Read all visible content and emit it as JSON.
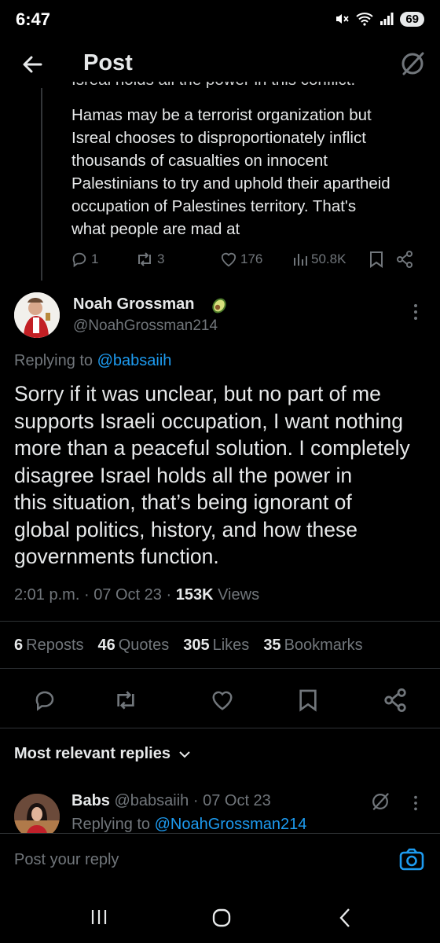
{
  "status": {
    "time": "6:47",
    "battery": "69"
  },
  "header": {
    "title": "Post"
  },
  "parent_tweet": {
    "cutoff_line": "Isreal holds all the power in this conflict.",
    "text": "Hamas may be a terrorist organization but\nIsreal chooses to disproportionately inflict\nthousands of casualties on innocent\nPalestinians to try and uphold their apartheid\noccupation of Palestines territory. That's\nwhat people are mad at",
    "replies": "1",
    "reposts": "3",
    "likes": "176",
    "views": "50.8K"
  },
  "main_tweet": {
    "author_name": "Noah Grossman",
    "author_handle": "@NoahGrossman214",
    "replying_prefix": "Replying to",
    "replying_handle": "@babsaiih",
    "body": "Sorry if it was unclear, but no part of me\nsupports Israeli occupation, I want nothing\nmore than a peaceful solution. I completely\ndisagree Israel holds all the power in\nthis situation, that’s being ignorant of\nglobal politics, history, and how these\ngovernments function.",
    "time": "2:01 p.m.",
    "date": "07 Oct 23",
    "views_count": "153K",
    "views_label": "Views",
    "separator": "·",
    "stats": {
      "reposts_count": "6",
      "reposts_label": "Reposts",
      "quotes_count": "46",
      "quotes_label": "Quotes",
      "likes_count": "305",
      "likes_label": "Likes",
      "bookmarks_count": "35",
      "bookmarks_label": "Bookmarks"
    }
  },
  "replies_section": {
    "sort_label": "Most relevant replies",
    "reply": {
      "name": "Babs",
      "handle": "@babsaiih",
      "separator": "·",
      "date": "07 Oct 23",
      "replying_prefix": "Replying to",
      "replying_handle": "@NoahGrossman214"
    }
  },
  "compose": {
    "placeholder": "Post your reply"
  },
  "colors": {
    "background": "#000000",
    "accent": "#1d9bf0",
    "muted": "#71767b",
    "text": "#e7e9ea"
  }
}
